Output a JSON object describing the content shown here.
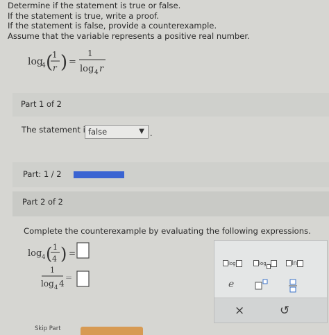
{
  "prompt": {
    "lines": [
      "Determine if the statement is true or false.",
      "If the statement is true, write a proof.",
      "If the statement is false, provide a counterexample.",
      "Assume that the variable represents a positive real number."
    ]
  },
  "statement_equation": {
    "log": "log",
    "base": "4",
    "numerator": "1",
    "variable": "r",
    "equals": "="
  },
  "part1": {
    "heading": "Part 1 of 2",
    "statement_label": "The statement is",
    "select_value": "false",
    "period": "."
  },
  "progress": {
    "label": "Part: 1 / 2",
    "fraction": 0.5
  },
  "part2": {
    "heading": "Part 2 of 2",
    "instruction": "Complete the counterexample by evaluating the following expressions.",
    "expr1": {
      "log": "log",
      "base": "4",
      "num": "1",
      "den": "4",
      "equals": "="
    },
    "expr2": {
      "num": "1",
      "log": "log",
      "base": "4",
      "arg": "4",
      "equals": "="
    }
  },
  "toolbar": {
    "log_label": "log",
    "log_base_label": "log",
    "ln_label": "ln",
    "e_label": "e",
    "clear": "×",
    "undo": "↺"
  },
  "footer": {
    "skip_label": "Skip Part"
  },
  "colors": {
    "progress": "#3a64d2",
    "panel_bg": "#e4e6e6",
    "button_orange": "#d79a53"
  }
}
